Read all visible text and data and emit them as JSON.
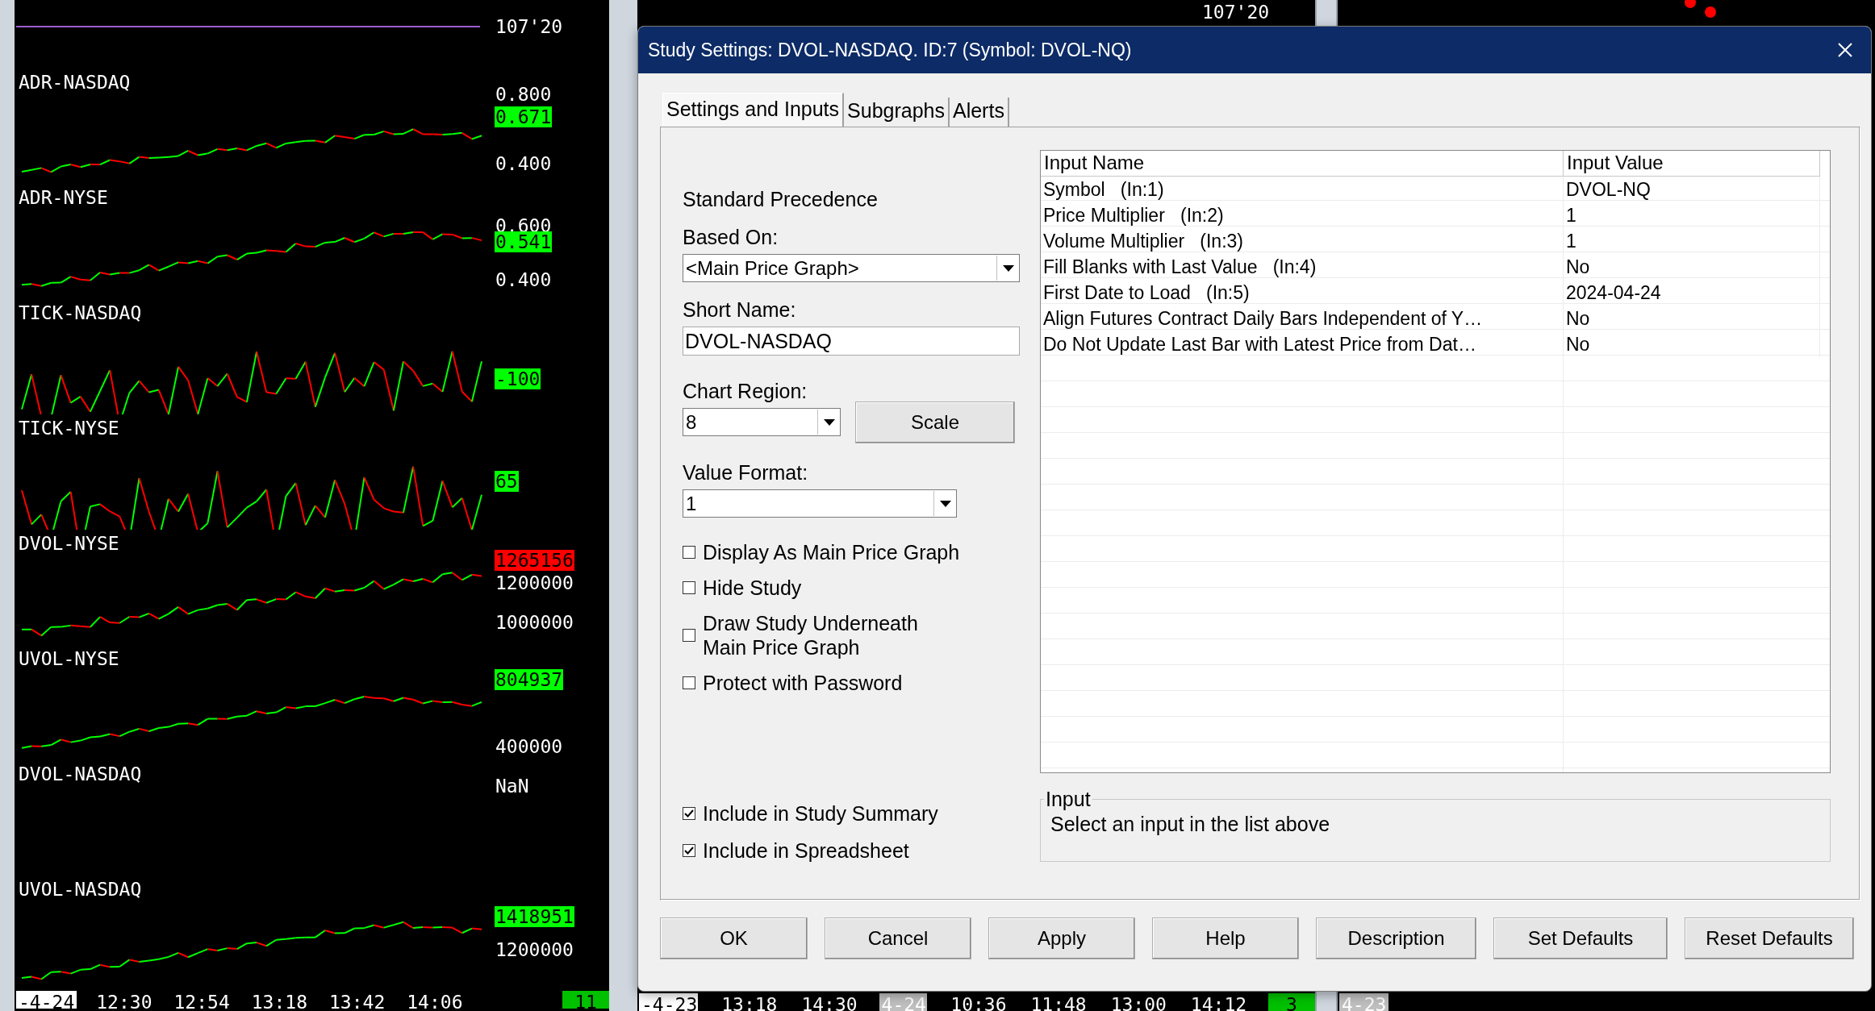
{
  "left_chart": {
    "top_pane": {
      "value": "107'20"
    },
    "panes": [
      {
        "label": "ADR-NASDAQ",
        "line_shown": true,
        "axis": [
          {
            "text": "0.800",
            "kind": "tick"
          },
          {
            "text": "0.671",
            "kind": "last",
            "color": "#00ff00"
          },
          {
            "text": "0.400",
            "kind": "tick"
          }
        ]
      },
      {
        "label": "ADR-NYSE",
        "line_shown": true,
        "axis": [
          {
            "text": "0.600",
            "kind": "tick"
          },
          {
            "text": "0.541",
            "kind": "last",
            "color": "#00ff00"
          },
          {
            "text": "0.400",
            "kind": "tick"
          }
        ]
      },
      {
        "label": "TICK-NASDAQ",
        "line_shown": true,
        "axis": [
          {
            "text": "-100",
            "kind": "last",
            "color": "#00ff00"
          }
        ]
      },
      {
        "label": "TICK-NYSE",
        "line_shown": true,
        "axis": [
          {
            "text": "65",
            "kind": "last",
            "color": "#00ff00"
          }
        ]
      },
      {
        "label": "DVOL-NYSE",
        "line_shown": true,
        "axis": [
          {
            "text": "1265156",
            "kind": "last",
            "color": "#ff0000"
          },
          {
            "text": "1200000",
            "kind": "tick"
          },
          {
            "text": "1000000",
            "kind": "tick"
          }
        ]
      },
      {
        "label": "UVOL-NYSE",
        "line_shown": true,
        "axis": [
          {
            "text": "804937",
            "kind": "last",
            "color": "#00ff00"
          },
          {
            "text": "400000",
            "kind": "tick"
          }
        ]
      },
      {
        "label": "DVOL-NASDAQ",
        "line_shown": false,
        "axis": [
          {
            "text": "NaN",
            "kind": "tick"
          }
        ]
      },
      {
        "label": "UVOL-NASDAQ",
        "line_shown": true,
        "axis": [
          {
            "text": "1418951",
            "kind": "last",
            "color": "#00ff00"
          },
          {
            "text": "1200000",
            "kind": "tick"
          }
        ]
      }
    ],
    "time_axis": [
      {
        "text": "-4-24",
        "kind": "date"
      },
      {
        "text": "12:30",
        "kind": "time"
      },
      {
        "text": "12:54",
        "kind": "time"
      },
      {
        "text": "13:18",
        "kind": "time"
      },
      {
        "text": "13:42",
        "kind": "time"
      },
      {
        "text": "14:06",
        "kind": "time"
      },
      {
        "text": "11",
        "kind": "count"
      }
    ]
  },
  "background_charts": {
    "top_value": "107'20",
    "middle_time_axis": [
      {
        "text": "-4-23",
        "kind": "date"
      },
      {
        "text": "13:18",
        "kind": "time"
      },
      {
        "text": "14:30",
        "kind": "time"
      },
      {
        "text": "4-24",
        "kind": "day"
      },
      {
        "text": "10:36",
        "kind": "time"
      },
      {
        "text": "11:48",
        "kind": "time"
      },
      {
        "text": "13:00",
        "kind": "time"
      },
      {
        "text": "14:12",
        "kind": "time"
      },
      {
        "text": "3",
        "kind": "count"
      }
    ],
    "right_time_axis": [
      {
        "text": "4-23",
        "kind": "day"
      }
    ]
  },
  "dialog": {
    "title": "Study Settings: DVOL-NASDAQ. ID:7 (Symbol: DVOL-NQ)",
    "tabs": [
      {
        "label": "Settings and Inputs",
        "selected": true
      },
      {
        "label": "Subgraphs",
        "selected": false
      },
      {
        "label": "Alerts",
        "selected": false
      }
    ],
    "settings": {
      "heading": "Standard Precedence",
      "based_on": {
        "label": "Based On:",
        "value": "<Main Price Graph>"
      },
      "short_name": {
        "label": "Short Name:",
        "value": "DVOL-NASDAQ"
      },
      "chart_region": {
        "label": "Chart Region:",
        "value": "8",
        "button": "Scale"
      },
      "value_format": {
        "label": "Value Format:",
        "value": "1"
      },
      "options": [
        {
          "label": "Display As Main Price Graph",
          "checked": false
        },
        {
          "label": "Hide Study",
          "checked": false
        },
        {
          "label": "Draw Study Underneath\nMain Price Graph",
          "checked": false
        },
        {
          "label": "Protect with Password",
          "checked": false
        }
      ],
      "summary_options": [
        {
          "label": "Include in Study Summary",
          "checked": true
        },
        {
          "label": "Include in Spreadsheet",
          "checked": true
        }
      ]
    },
    "inputs_table": {
      "columns": [
        "Input Name",
        "Input Value"
      ],
      "rows": [
        {
          "name": "Symbol   (In:1)",
          "value": "DVOL-NQ"
        },
        {
          "name": "Price Multiplier   (In:2)",
          "value": "1"
        },
        {
          "name": "Volume Multiplier   (In:3)",
          "value": "1"
        },
        {
          "name": "Fill Blanks with Last Value   (In:4)",
          "value": "No"
        },
        {
          "name": "First Date to Load   (In:5)",
          "value": "2024-04-24"
        },
        {
          "name": "Align Futures Contract Daily Bars Independent of Y…",
          "value": "No"
        },
        {
          "name": "Do Not Update Last Bar with Latest Price from Dat…",
          "value": "No"
        }
      ]
    },
    "input_group": {
      "legend": "Input",
      "text": "Select an input in the list above"
    },
    "buttons": [
      "OK",
      "Cancel",
      "Apply",
      "Help",
      "Description",
      "Set Defaults",
      "Reset Defaults"
    ]
  }
}
